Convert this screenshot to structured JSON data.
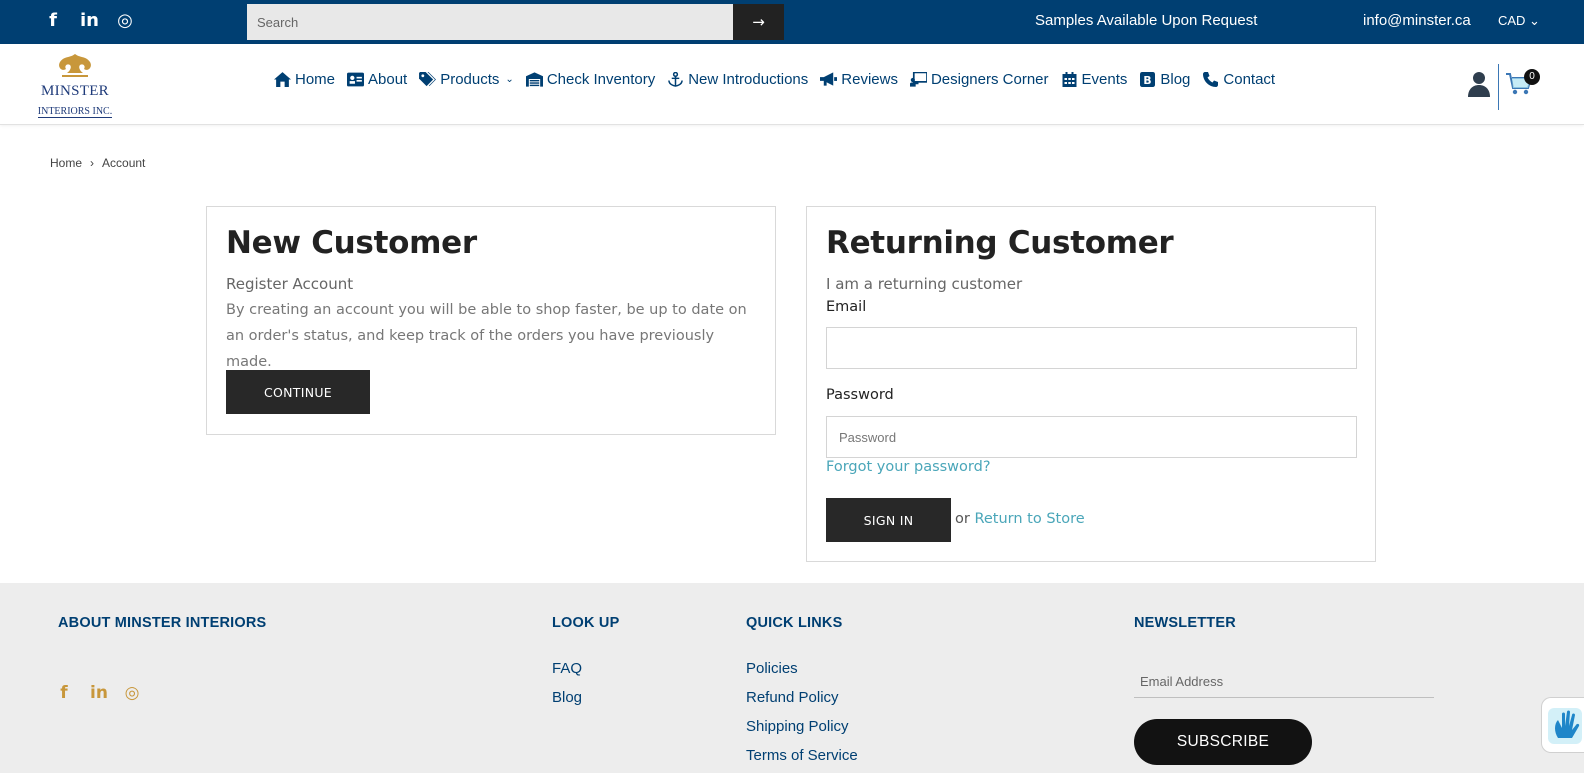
{
  "topbar": {
    "social": [
      {
        "name": "facebook-icon",
        "glyph": "f"
      },
      {
        "name": "linkedin-icon",
        "glyph": "in"
      },
      {
        "name": "instagram-icon",
        "glyph": "◎"
      }
    ],
    "search_placeholder": "Search",
    "search_button": "→",
    "samples_text": "Samples Available Upon Request",
    "email": "info@minster.ca",
    "currency": "CAD ⌄"
  },
  "header": {
    "logo_line1": "MINSTER",
    "logo_line2": "INTERIORS INC.",
    "nav": [
      {
        "label": "Home",
        "icon": "home-icon"
      },
      {
        "label": "About",
        "icon": "id-card-icon"
      },
      {
        "label": "Products",
        "icon": "tags-icon",
        "has_chevron": true
      },
      {
        "label": "Check Inventory",
        "icon": "warehouse-icon"
      },
      {
        "label": "New Introductions",
        "icon": "anchor-icon"
      },
      {
        "label": "Reviews",
        "icon": "megaphone-icon"
      },
      {
        "label": "Designers Corner",
        "icon": "chalkboard-icon"
      },
      {
        "label": "Events",
        "icon": "calendar-icon"
      },
      {
        "label": "Blog",
        "icon": "blog-icon"
      },
      {
        "label": "Contact",
        "icon": "phone-icon"
      }
    ],
    "cart_count": "0",
    "colors": {
      "brand": "#003f72",
      "accent_gold": "#c8973b",
      "teal_link": "#4aa6b9"
    }
  },
  "breadcrumb": {
    "home": "Home",
    "separator": "›",
    "current": "Account"
  },
  "new_customer": {
    "title": "New Customer",
    "subtitle": "Register Account",
    "description": "By creating an account you will be able to shop faster, be up to date on an order's status, and keep track of the orders you have previously made.",
    "button": "CONTINUE"
  },
  "returning_customer": {
    "title": "Returning Customer",
    "subtitle": "I am a returning customer",
    "email_label": "Email",
    "email_value": "",
    "password_label": "Password",
    "password_placeholder": "Password",
    "forgot_link": "Forgot your password?",
    "signin_button": "SIGN IN",
    "or_text": "or",
    "return_link": "Return to Store"
  },
  "footer": {
    "about_heading": "ABOUT MINSTER INTERIORS",
    "lookup_heading": "LOOK UP",
    "lookup_links": [
      "FAQ",
      "Blog"
    ],
    "quick_heading": "QUICK LINKS",
    "quick_links": [
      "Policies",
      "Refund Policy",
      "Shipping Policy",
      "Terms of Service"
    ],
    "newsletter_heading": "NEWSLETTER",
    "newsletter_placeholder": "Email Address",
    "subscribe_button": "SUBSCRIBE"
  }
}
